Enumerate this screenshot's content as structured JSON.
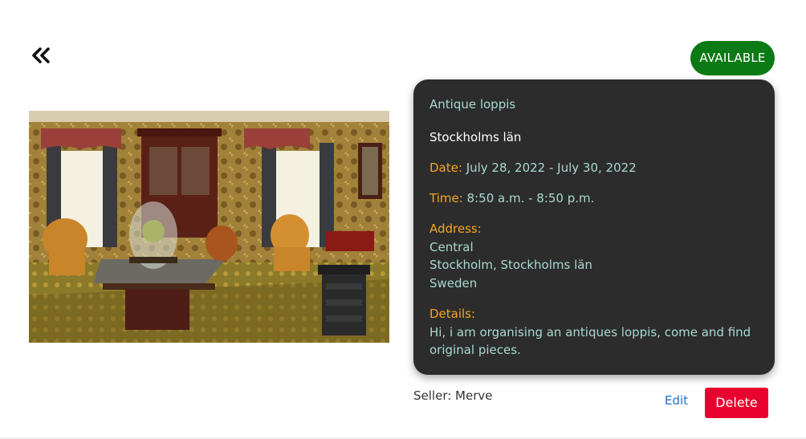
{
  "status": {
    "label": "AVAILABLE",
    "color": "#0b7a14"
  },
  "back": {
    "icon": "double-chevron-left-icon"
  },
  "listing": {
    "title": "Antique loppis",
    "region": "Stockholms län",
    "date_label": "Date:",
    "date_value": "July 28, 2022 - July 30, 2022",
    "time_label": "Time:",
    "time_value": "8:50 a.m. - 8:50 p.m.",
    "address_label": "Address:",
    "address_line1": "Central",
    "address_line2": "Stockholm, Stockholms län",
    "address_line3": "Sweden",
    "details_label": "Details:",
    "details_text": "Hi, i am organising an antiques loppis, come and find original pieces."
  },
  "seller_text": "Seller: Merve",
  "actions": {
    "edit_label": "Edit",
    "delete_label": "Delete",
    "delete_color": "#e8002f"
  },
  "colors": {
    "card_bg": "#2c2c2c",
    "label": "#f5a623",
    "value": "#a9d9d0"
  }
}
